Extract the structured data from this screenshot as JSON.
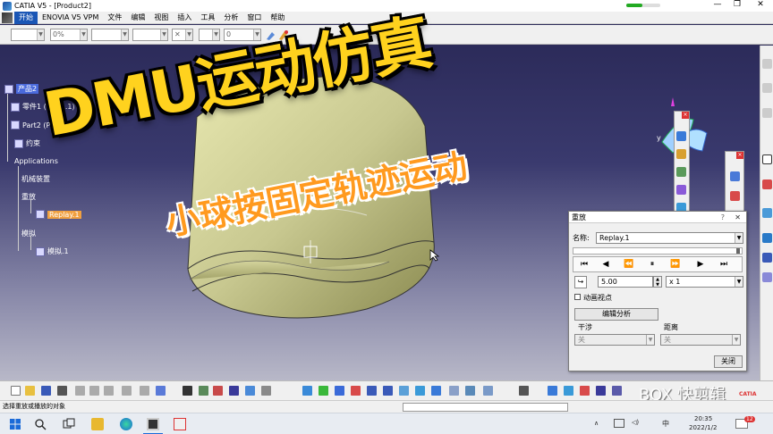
{
  "window": {
    "title": "CATIA V5 - [Product2]",
    "minimize": "—",
    "restore": "❐",
    "close": "✕"
  },
  "menu": [
    "开始",
    "ENOVIA V5 VPM",
    "文件",
    "编辑",
    "视图",
    "插入",
    "工具",
    "分析",
    "窗口",
    "帮助"
  ],
  "toolbar": {
    "percent": "0%",
    "number": "0"
  },
  "tree": {
    "root": "产品2",
    "part1": "零件1 (零件1.1)",
    "part2": "Part2 (Part2.1)",
    "constraints": "约束",
    "applications": "Applications",
    "mechanism": "机械装置",
    "replays": "重放",
    "replay_item": "Replay.1",
    "simulation": "模拟",
    "simulation_item": "模拟.1"
  },
  "overlay": {
    "headline": "DMU运动仿真",
    "subhead": "小球按固定轨迹运动"
  },
  "replay_dialog": {
    "title": "重放",
    "help": "?",
    "close_x": "✕",
    "name_label": "名称:",
    "name_value": "Replay.1",
    "step_value": "5.00",
    "speed_value": "x 1",
    "animate_label": "动画视点",
    "edit_analysis": "编辑分析",
    "interference_label": "干涉",
    "interference_value": "关",
    "distance_label": "距离",
    "distance_value": "关",
    "close_button": "关闭"
  },
  "status": {
    "message": "选择重放或播放的对象"
  },
  "taskbar": {
    "time": "20:35",
    "date": "2022/1/2",
    "lang": "中",
    "badge": "12"
  },
  "watermark": "BOX 快剪辑",
  "brand": "CATIA",
  "compass": {
    "y": "y",
    "x": "x"
  },
  "colors": {
    "accent": "#1a56b5",
    "headline": "#ffd21e",
    "subhead": "#ff9a1f",
    "selection": "#f0a040"
  }
}
